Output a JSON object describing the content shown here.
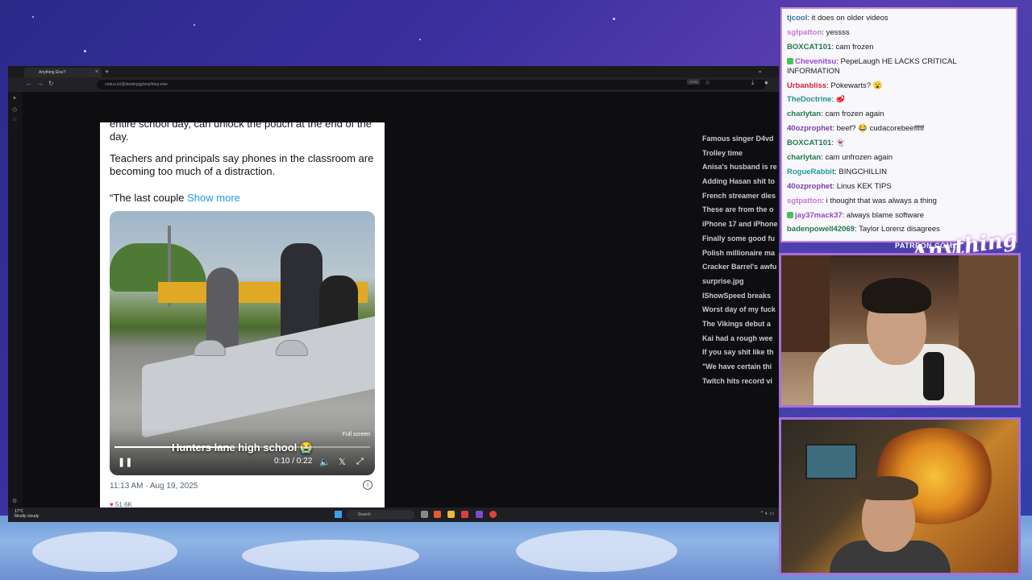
{
  "browser": {
    "tab_title": "Anything Else?",
    "tab_close": "×",
    "new_tab": "+",
    "menu_chevron": "⌄",
    "url": "coduo.io/@destinygg/anything-else",
    "zoom": "170%",
    "icons": [
      "back-arrow-icon",
      "forward-arrow-icon",
      "reload-icon",
      "lock-icon",
      "bookmark-star-icon",
      "download-icon",
      "extensions-icon",
      "profile-icon"
    ]
  },
  "tweet": {
    "text_top": "entire school day, can unlock the pouch at the end of the day.",
    "text_mid": "Teachers and principals say phones in the classroom are becoming too much of a distraction.",
    "text_quote": "“The last couple",
    "show_more": "Show more",
    "video": {
      "overlay_title": "Hunters lane high school 😭",
      "fullscreen_tip": "Full screen",
      "time": "0:10 / 0:22",
      "progress_fraction": 0.45
    },
    "timestamp": "11:13 AM · Aug 19, 2025",
    "actions_peek": "51.6K"
  },
  "side_list": [
    "Famous singer D4vd",
    "Trolley time",
    "Anisa's husband is re",
    "Adding Hasan shit to",
    "French streamer dies",
    "These are from the o",
    "iPhone 17 and iPhone",
    "Finally some good fu",
    "Polish millionaire ma",
    "Cracker Barrel's awfu",
    "surprise.jpg",
    "IShowSpeed breaks",
    "Worst day of my fuck",
    "The Vikings debut a",
    "Kai had a rough wee",
    "If you say shit like th",
    "\"We have certain thi",
    "Twitch hits record vi"
  ],
  "taskbar": {
    "weather_temp": "17°C",
    "weather_desc": "Mostly cloudy",
    "search_label": "Search"
  },
  "chat": [
    {
      "user": "tjcool",
      "color": "#2c7a9a",
      "text": "it does on older videos",
      "badge": false
    },
    {
      "user": "sgtpatton",
      "color": "#c77ad8",
      "text": "yessss",
      "badge": false
    },
    {
      "user": "BOXCAT101",
      "color": "#1f7a4a",
      "text": "cam frozen",
      "badge": false
    },
    {
      "user": "Chevenitsu",
      "color": "#9a46c8",
      "text": "PepeLaugh HE LACKS CRITICAL INFORMATION",
      "badge": true
    },
    {
      "user": "Urbanbliss",
      "color": "#d0243a",
      "text": "Pokewarts? 😮",
      "badge": false
    },
    {
      "user": "TheDoctrine",
      "color": "#1e8f8f",
      "text": "🥩",
      "badge": false
    },
    {
      "user": "charlytan",
      "color": "#1f7a4a",
      "text": "cam frozen again",
      "badge": false
    },
    {
      "user": "40ozprophet",
      "color": "#7a3fa8",
      "text": "beef? 😂 cudacorebeefffff",
      "badge": false
    },
    {
      "user": "BOXCAT101",
      "color": "#1f7a4a",
      "text": "👻",
      "badge": false
    },
    {
      "user": "charlytan",
      "color": "#1f7a4a",
      "text": "cam unfrozen again",
      "badge": false
    },
    {
      "user": "RogueRabbit",
      "color": "#1f9a9a",
      "text": "BINGCHILLIN",
      "badge": false
    },
    {
      "user": "40ozprophet",
      "color": "#7a3fa8",
      "text": "Linus KEK TIPS",
      "badge": false
    },
    {
      "user": "sgtpatton",
      "color": "#c77ad8",
      "text": "i thought that was always a thing",
      "badge": false
    },
    {
      "user": "jay37mack37",
      "color": "#9a46c8",
      "text": "always blame software",
      "badge": true
    },
    {
      "user": "badenpowell42069",
      "color": "#1f7a4a",
      "text": "Taylor Lorenz disagrees",
      "badge": false
    }
  ],
  "overlay": {
    "patreon": "PATREON.COM/",
    "logo": "Anything Else?"
  }
}
